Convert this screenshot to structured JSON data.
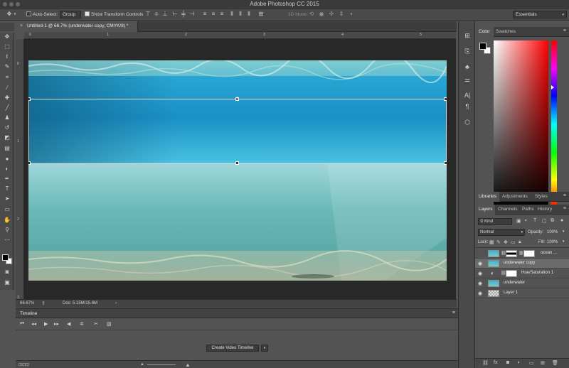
{
  "app": {
    "title": "Adobe Photoshop CC 2015"
  },
  "options_bar": {
    "auto_select_label": "Auto-Select:",
    "auto_select_value": "Group",
    "show_transform_label": "Show Transform Controls",
    "mode_3d_label": "3D Mode:",
    "workspace": "Essentials"
  },
  "document": {
    "tab_label": "Untitled-1 @ 66.7% (underwater copy, CMYK/8) *",
    "ruler_h_ticks": [
      "0",
      "1",
      "2",
      "3",
      "4",
      "5"
    ],
    "ruler_v_ticks": [
      "0",
      "1",
      "2",
      "3"
    ]
  },
  "status": {
    "zoom": "66.67%",
    "doc_info": "Doc: 5.15M/15.6M"
  },
  "timeline": {
    "title": "Timeline",
    "create_button": "Create Video Timeline"
  },
  "color_panel": {
    "tabs": [
      "Color",
      "Swatches"
    ],
    "active_tab": "Color"
  },
  "libraries_panel": {
    "tabs": [
      "Libraries",
      "Adjustments",
      "Styles"
    ],
    "active_tab": "Libraries"
  },
  "layers_panel": {
    "tabs": [
      "Layers",
      "Channels",
      "Paths",
      "History"
    ],
    "active_tab": "Layers",
    "filter_kind": "Kind",
    "blend_mode": "Normal",
    "opacity_label": "Opacity:",
    "opacity_value": "100%",
    "lock_label": "Lock:",
    "fill_label": "Fill:",
    "fill_value": "100%",
    "layers": [
      {
        "name": "ocean ...",
        "visible": false,
        "selected": false
      },
      {
        "name": "underwater copy",
        "visible": true,
        "selected": true
      },
      {
        "name": "Hue/Saturation 1",
        "visible": true,
        "selected": false
      },
      {
        "name": "underwater",
        "visible": true,
        "selected": false
      },
      {
        "name": "Layer 1",
        "visible": true,
        "selected": false
      }
    ]
  },
  "colors": {
    "chrome_dark": "#3a3a3a",
    "panel_bg": "#535353",
    "selected_row": "#6b6b6b",
    "water_top": "#1a9fd0",
    "water_bottom": "#7ec9c0"
  }
}
